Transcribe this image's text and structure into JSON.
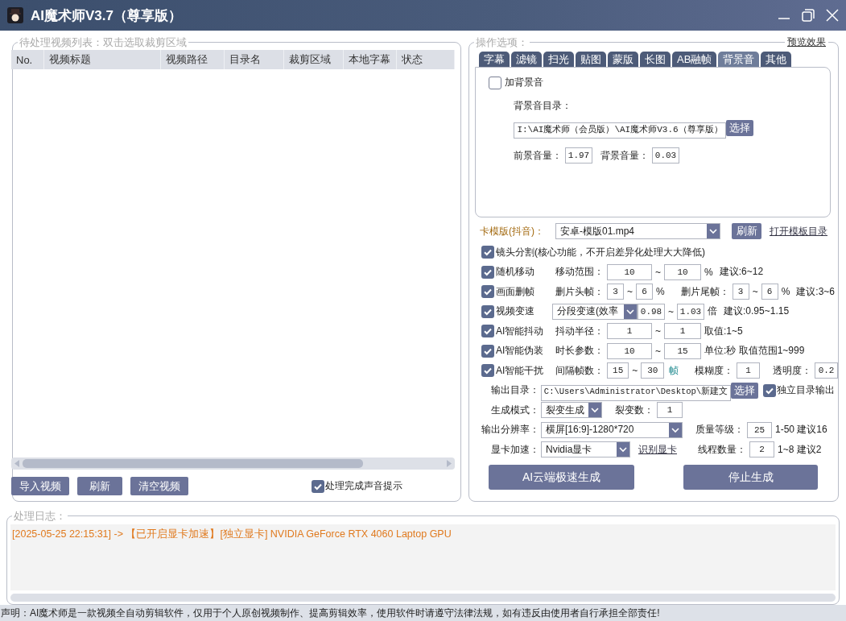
{
  "window": {
    "title": "AI魔术师V3.7（尊享版）"
  },
  "video_list": {
    "legend": "待处理视频列表：双击选取裁剪区域",
    "columns": [
      "No.",
      "视频标题",
      "视频路径",
      "目录名",
      "裁剪区域",
      "本地字幕",
      "状态"
    ],
    "buttons": [
      "导入视频",
      "刷新",
      "清空视频"
    ],
    "sound_prompt": {
      "label": "处理完成声音提示",
      "checked": true
    }
  },
  "options": {
    "legend": "操作选项：",
    "preview_link": "预览效果",
    "tabs": [
      {
        "label": "字幕",
        "selected": false
      },
      {
        "label": "滤镜",
        "selected": false
      },
      {
        "label": "扫光",
        "selected": false
      },
      {
        "label": "贴图",
        "selected": false
      },
      {
        "label": "蒙版",
        "selected": false
      },
      {
        "label": "长图",
        "selected": false
      },
      {
        "label": "AB融帧",
        "selected": false
      },
      {
        "label": "背景音",
        "selected": true
      },
      {
        "label": "其他",
        "selected": false
      }
    ],
    "bgm": {
      "enabled": {
        "label": "加背景音",
        "checked": false
      },
      "dir_label": "背景音目录：",
      "dir_value": "I:\\AI魔术师（会员版）\\AI魔术师V3.6（尊享版）",
      "choose_button": "选择",
      "fg_label": "前景音量：",
      "fg_value": "1.97",
      "bg_label": "背景音量：",
      "bg_value": "0.03"
    },
    "template": {
      "label": "卡模版(抖音)：",
      "value": "安卓-模版01.mp4",
      "button": "刷新",
      "link": "打开模板目录"
    },
    "rows": [
      {
        "kind": "option",
        "checked": true,
        "label": "镜头分割(核心功能，不开启差异化处理大大降低)",
        "parts": []
      },
      {
        "kind": "option",
        "checked": true,
        "label": "随机移动",
        "parts": [
          {
            "kind": "text",
            "text": "移动范围："
          },
          {
            "kind": "field",
            "value": "10"
          },
          {
            "kind": "text",
            "text": "~"
          },
          {
            "kind": "field",
            "value": "10"
          },
          {
            "kind": "text",
            "text": "%"
          },
          {
            "kind": "text",
            "text": "建议:6~12"
          }
        ]
      },
      {
        "kind": "option",
        "checked": true,
        "label": "画面删帧",
        "parts": [
          {
            "kind": "text",
            "text": "删片头帧："
          },
          {
            "kind": "field",
            "value": "3"
          },
          {
            "kind": "text",
            "text": "~"
          },
          {
            "kind": "field",
            "value": "6"
          },
          {
            "kind": "text",
            "text": "%"
          },
          {
            "kind": "text",
            "text": "删片尾帧："
          },
          {
            "kind": "field",
            "value": "3"
          },
          {
            "kind": "text",
            "text": "~"
          },
          {
            "kind": "field",
            "value": "6"
          },
          {
            "kind": "text",
            "text": "%"
          },
          {
            "kind": "text",
            "text": "建议:3~6"
          }
        ]
      },
      {
        "kind": "option",
        "checked": true,
        "label": "视频变速",
        "parts": [
          {
            "kind": "select",
            "value": "分段变速(效率"
          },
          {
            "kind": "field",
            "value": "0.98"
          },
          {
            "kind": "text",
            "text": "~"
          },
          {
            "kind": "field",
            "value": "1.03"
          },
          {
            "kind": "text",
            "text": "倍"
          },
          {
            "kind": "text",
            "text": "建议:0.95~1.15"
          }
        ]
      },
      {
        "kind": "option",
        "checked": true,
        "label": "AI智能抖动",
        "parts": [
          {
            "kind": "text",
            "text": "抖动半径："
          },
          {
            "kind": "field",
            "value": "1"
          },
          {
            "kind": "text",
            "text": "~"
          },
          {
            "kind": "field",
            "value": "1"
          },
          {
            "kind": "text",
            "text": "取值:1~5"
          }
        ]
      },
      {
        "kind": "option",
        "checked": true,
        "label": "AI智能伪装",
        "parts": [
          {
            "kind": "text",
            "text": "时长参数："
          },
          {
            "kind": "field",
            "value": "10"
          },
          {
            "kind": "text",
            "text": "~"
          },
          {
            "kind": "field",
            "value": "15"
          },
          {
            "kind": "text",
            "text": "单位:秒 取值范围1~999"
          }
        ]
      },
      {
        "kind": "option",
        "checked": true,
        "label": "AI智能干扰",
        "parts": [
          {
            "kind": "text",
            "text": "间隔帧数："
          },
          {
            "kind": "field",
            "value": "15"
          },
          {
            "kind": "text",
            "text": "~"
          },
          {
            "kind": "field",
            "value": "30"
          },
          {
            "kind": "accent",
            "text": "帧"
          },
          {
            "kind": "text",
            "text": "模糊度："
          },
          {
            "kind": "field",
            "value": "1"
          },
          {
            "kind": "text",
            "text": "透明度："
          },
          {
            "kind": "field",
            "value": "0.2"
          }
        ]
      },
      {
        "kind": "setting",
        "label": "输出目录：",
        "parts": [
          {
            "kind": "path",
            "value": "C:\\Users\\Administrator\\Desktop\\新建文"
          },
          {
            "kind": "button",
            "text": "选择"
          },
          {
            "kind": "check",
            "checked": true,
            "text": "独立目录输出"
          }
        ]
      },
      {
        "kind": "setting",
        "label": "生成模式：",
        "parts": [
          {
            "kind": "select",
            "value": "裂变生成"
          },
          {
            "kind": "text",
            "text": "裂变数："
          },
          {
            "kind": "field",
            "value": "1"
          }
        ]
      },
      {
        "kind": "setting",
        "label": "输出分辨率：",
        "parts": [
          {
            "kind": "select",
            "value": "横屏[16:9]-1280*720"
          },
          {
            "kind": "text",
            "text": "质量等级："
          },
          {
            "kind": "field",
            "value": "25"
          },
          {
            "kind": "text",
            "text": "1-50 建议16"
          }
        ]
      },
      {
        "kind": "setting",
        "label": "显卡加速：",
        "parts": [
          {
            "kind": "select",
            "value": "Nvidia显卡"
          },
          {
            "kind": "link",
            "text": "识别显卡"
          },
          {
            "kind": "text",
            "text": "线程数量："
          },
          {
            "kind": "field",
            "value": "2"
          },
          {
            "kind": "text",
            "text": "1~8 建议2"
          }
        ]
      }
    ],
    "buttons": [
      "AI云端极速生成",
      "停止生成"
    ]
  },
  "log": {
    "legend": "处理日志：",
    "lines": [
      "[2025-05-25 22:15:31] -> 【已开启显卡加速】[独立显卡] NVIDIA GeForce RTX 4060 Laptop GPU"
    ]
  },
  "status_bar": "声明：AI魔术师是一款视频全自动剪辑软件，仅用于个人原创视频制作、提高剪辑效率，使用软件时请遵守法律法规，如有违反由使用者自行承担全部责任!"
}
